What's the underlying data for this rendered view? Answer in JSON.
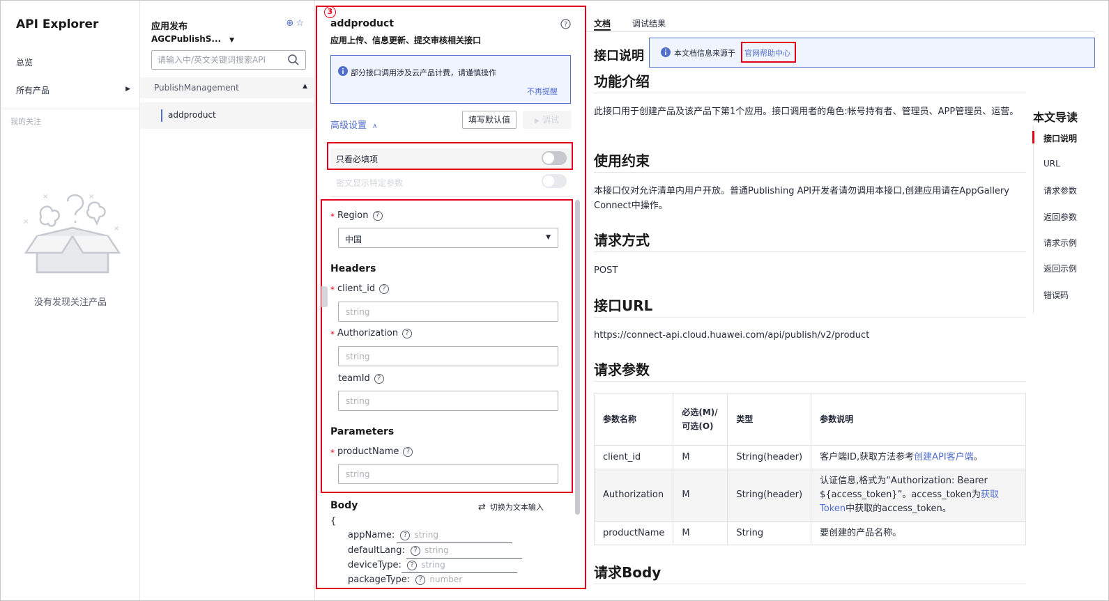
{
  "sidebar": {
    "app_title": "API Explorer",
    "overview": "总览",
    "all_products": "所有产品",
    "my_follow": "我的关注",
    "empty_text": "没有发现关注产品"
  },
  "service": {
    "title": "应用发布",
    "selected": "AGCPublishS...",
    "search_placeholder": "请输入中/英文关键词搜索API",
    "group": "PublishManagement",
    "api_item": "addproduct"
  },
  "form": {
    "badge": "3",
    "api_name": "addproduct",
    "api_desc": "应用上传、信息更新、提交审核相关接口",
    "notice": "部分接口调用涉及云产品计费，请谨慎操作",
    "dismiss": "不再提醒",
    "advanced": "高级设置",
    "fill_default": "填写默认值",
    "debug": "调试",
    "only_required": "只看必填项",
    "plain_show": "密文显示特定参数",
    "region_label": "Region",
    "region_value": "中国",
    "headers_title": "Headers",
    "client_id_label": "client_id",
    "authorization_label": "Authorization",
    "teamid_label": "teamId",
    "parameters_title": "Parameters",
    "product_name_label": "productName",
    "string_placeholder": "string",
    "body_title": "Body",
    "switch_text": "切换为文本输入",
    "brace": "{",
    "body_fields": [
      {
        "name": "appName:",
        "type": "string"
      },
      {
        "name": "defaultLang:",
        "type": "string"
      },
      {
        "name": "deviceType:",
        "type": "string"
      },
      {
        "name": "packageType:",
        "type": "number"
      }
    ]
  },
  "doc": {
    "tab_doc": "文档",
    "tab_result": "调试结果",
    "section_api_desc": "接口说明",
    "source_text": "本文档信息来源于",
    "source_link": "官网帮助中心",
    "h_intro": "功能介绍",
    "p_intro": "此接口用于创建产品及该产品下第1个应用。接口调用者的角色:帐号持有者、管理员、APP管理员、运营。",
    "h_constraint": "使用约束",
    "p_constraint": "本接口仅对允许清单内用户开放。普通Publishing API开发者请勿调用本接口,创建应用请在AppGallery Connect中操作。",
    "h_method": "请求方式",
    "p_method": "POST",
    "h_url": "接口URL",
    "p_url": "https://connect-api.cloud.huawei.com/api/publish/v2/product",
    "h_params": "请求参数",
    "table_headers": [
      "参数名称",
      "必选(M)/可选(O)",
      "类型",
      "参数说明"
    ],
    "rows": [
      {
        "name": "client_id",
        "req": "M",
        "type": "String(header)",
        "desc_pre": "客户端ID,获取方法参考",
        "desc_link": "创建API客户端",
        "desc_post": "。"
      },
      {
        "name": "Authorization",
        "req": "M",
        "type": "String(header)",
        "desc_pre": "认证信息,格式为“Authorization: Bearer ${access_token}”。access_token为",
        "desc_link": "获取Token",
        "desc_post": "中获取的access_token。"
      },
      {
        "name": "productName",
        "req": "M",
        "type": "String",
        "desc_pre": "要创建的产品名称。",
        "desc_link": "",
        "desc_post": ""
      }
    ],
    "h_body": "请求Body"
  },
  "toc": {
    "title": "本文导读",
    "items": [
      "接口说明",
      "URL",
      "请求参数",
      "返回参数",
      "请求示例",
      "返回示例",
      "错误码"
    ]
  },
  "colors": {
    "accent": "#526ecc",
    "highlight_red": "#e5001a",
    "required_star": "#e5001a"
  }
}
